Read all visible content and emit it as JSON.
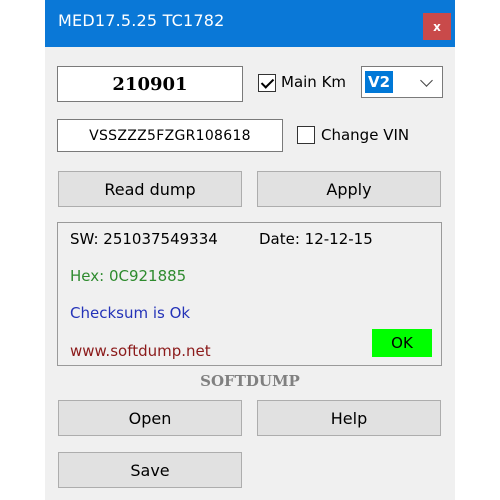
{
  "window": {
    "title": "MED17.5.25 TC1782",
    "close_label": "x"
  },
  "form": {
    "km_value": "210901",
    "main_km_label": "Main Km",
    "main_km_checked": true,
    "version_selected": "V2",
    "vin_value": "VSSZZZ5FZGR108618",
    "change_vin_label": "Change VIN",
    "change_vin_checked": false
  },
  "buttons": {
    "read_dump": "Read dump",
    "apply": "Apply",
    "open": "Open",
    "help": "Help",
    "save": "Save"
  },
  "info": {
    "sw": "SW: 251037549334",
    "date": "Date: 12-12-15",
    "hex": "Hex: 0C921885",
    "checksum": "Checksum is Ok",
    "website": "www.softdump.net",
    "status": "OK"
  },
  "brand": "SOFTDUMP",
  "colors": {
    "titlebar": "#0a78d7",
    "close": "#c94a4a",
    "hex_text": "#2e8b2e",
    "checksum_text": "#2433b8",
    "website_text": "#8b1a1a",
    "ok_badge": "#00ff00"
  }
}
